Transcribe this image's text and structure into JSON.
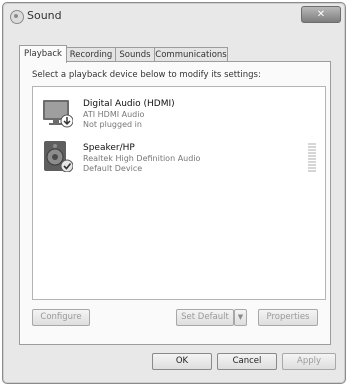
{
  "window": {
    "title": "Sound",
    "close_glyph": "✕"
  },
  "tabs": [
    {
      "label": "Playback",
      "active": true
    },
    {
      "label": "Recording",
      "active": false
    },
    {
      "label": "Sounds",
      "active": false
    },
    {
      "label": "Communications",
      "active": false
    }
  ],
  "panel": {
    "instruction": "Select a playback device below to modify its settings:"
  },
  "devices": [
    {
      "name": "Digital Audio (HDMI)",
      "driver": "ATI HDMI Audio",
      "status": "Not plugged in",
      "icon": "monitor-icon",
      "badge": "down-arrow-badge"
    },
    {
      "name": "Speaker/HP",
      "driver": "Realtek High Definition Audio",
      "status": "Default Device",
      "icon": "speaker-icon",
      "badge": "checkmark-badge"
    }
  ],
  "buttons": {
    "configure": "Configure",
    "set_default": "Set Default",
    "properties": "Properties",
    "ok": "OK",
    "cancel": "Cancel",
    "apply": "Apply"
  }
}
